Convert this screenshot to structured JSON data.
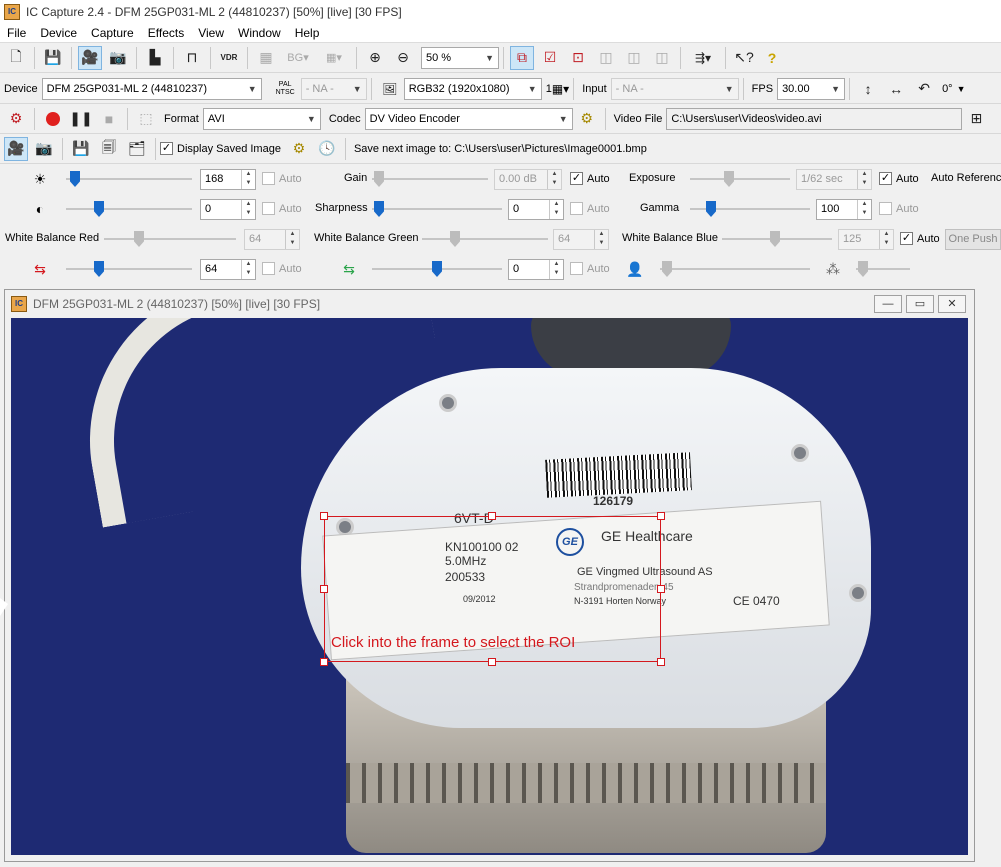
{
  "app": {
    "title": "IC Capture 2.4 - DFM 25GP031-ML 2 (44810237) [50%] [live] [30 FPS]",
    "icon_text": "IC"
  },
  "menu": [
    "File",
    "Device",
    "Capture",
    "Effects",
    "View",
    "Window",
    "Help"
  ],
  "toolbar": {
    "icons": [
      "new-file-icon",
      "save-icon",
      "camera-live-icon",
      "snapshot-icon",
      "histogram-icon",
      "trigger-icon",
      "vdr-icon",
      "bg-icon",
      "overlay-icon",
      "zoom-in-icon",
      "zoom-out-icon",
      "roi-icon",
      "roi-set-icon",
      "roi-center-icon",
      "roi-a-icon",
      "roi-b-icon",
      "roi-c-icon",
      "network-icon",
      "help-context-icon",
      "help-icon"
    ],
    "vdr_label": "VDR",
    "bg_label": "BG",
    "zoom": "50 %"
  },
  "device_row": {
    "device_label": "Device",
    "device_value": "DFM 25GP031-ML 2 (44810237)",
    "pal_label": "PAL",
    "ntsc_label": "NTSC",
    "norm_value": "- NA -",
    "format_value": "RGB32 (1920x1080)",
    "format_count": "1",
    "input_label": "Input",
    "input_value": "- NA -",
    "fps_label": "FPS",
    "fps_value": "30.00",
    "rotation": "0°"
  },
  "capture_row": {
    "format_label": "Format",
    "format_value": "AVI",
    "codec_label": "Codec",
    "codec_value": "DV Video Encoder",
    "videofile_label": "Video File",
    "videofile_value": "C:\\Users\\user\\Videos\\video.avi"
  },
  "image_row": {
    "display_saved_label": "Display Saved Image",
    "display_saved_checked": true,
    "save_next_label": "Save next image to: C:\\Users\\user\\Pictures\\Image0001.bmp"
  },
  "properties": {
    "brightness": {
      "value": "168",
      "auto": "Auto",
      "checked": false
    },
    "gain": {
      "label": "Gain",
      "value": "0.00 dB",
      "auto": "Auto",
      "checked": true
    },
    "exposure": {
      "label": "Exposure",
      "value": "1/62 sec",
      "auto": "Auto",
      "checked": true
    },
    "auto_reference_label": "Auto Referenc",
    "contrast": {
      "value": "0",
      "auto": "Auto",
      "checked": false
    },
    "sharpness": {
      "label": "Sharpness",
      "value": "0",
      "auto": "Auto",
      "checked": false
    },
    "gamma": {
      "label": "Gamma",
      "value": "100",
      "auto": "Auto",
      "checked": false
    },
    "wb_red": {
      "label": "White Balance Red",
      "value": "64"
    },
    "wb_green": {
      "label": "White Balance Green",
      "value": "64"
    },
    "wb_blue": {
      "label": "White Balance Blue",
      "value": "125",
      "auto": "Auto",
      "checked": true
    },
    "one_push_label": "One Push",
    "hue": {
      "value": "64",
      "auto": "Auto",
      "checked": false
    },
    "saturation": {
      "value": "0",
      "auto": "Auto",
      "checked": false
    }
  },
  "subwindow": {
    "title": "DFM 25GP031-ML 2 (44810237) [50%]  [live]  [30 FPS]",
    "minimize": "—",
    "restore": "▭",
    "close": "✕"
  },
  "video": {
    "roi_hint": "Click into the frame to select the ROI",
    "barcode_number": "126179",
    "model": "6VT-D",
    "serial": "KN100100 02",
    "frequency": "5.0MHz",
    "part": "200533",
    "date": "09/2012",
    "brand": "GE Healthcare",
    "maker": "GE Vingmed Ultrasound AS",
    "address1": "Strandpromenaden 45",
    "address2": "N-3191 Horten  Norway",
    "ce": "CE 0470"
  }
}
